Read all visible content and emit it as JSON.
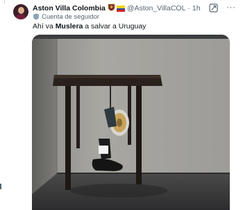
{
  "tweet": {
    "author_name": "Aston Villa Colombia",
    "verified_badge": "lion-crest-badge",
    "flag": "colombia-flag",
    "handle": "@Aston_VillaCOL",
    "separator": "·",
    "time": "1h",
    "more_label": "···",
    "follow_status": "Cuenta de seguidor",
    "text_prefix": "Ahí va ",
    "text_bold": "Muslera",
    "text_suffix": " a salvar a Uruguay"
  },
  "icons": [
    "avatar",
    "lion-crest-badge",
    "colombia-flag",
    "grok-icon",
    "more-options-icon",
    "shield-icon"
  ],
  "colors": {
    "text": "#0f1419",
    "secondary": "#536471",
    "flag_yellow": "#f8d21c",
    "flag_blue": "#2a49a8",
    "flag_red": "#d6202d"
  }
}
